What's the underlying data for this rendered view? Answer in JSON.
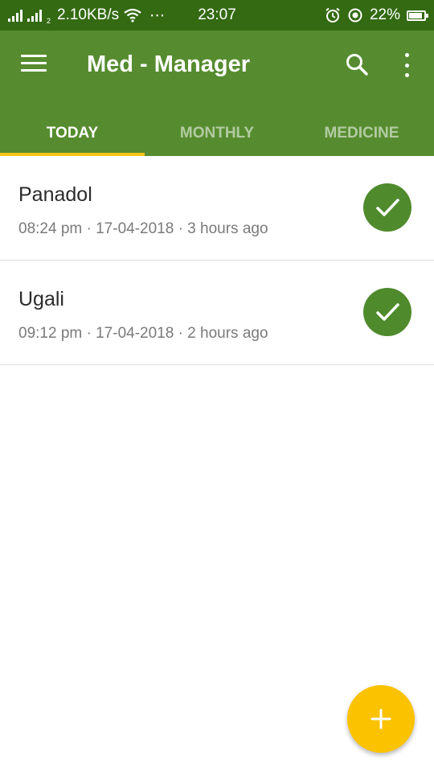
{
  "status_bar": {
    "sim_tag": "2",
    "net_speed": "2.10KB/s",
    "more": "⋯",
    "time": "23:07",
    "battery": "22%",
    "battery_level": 0.22,
    "icons": [
      "signal-icon",
      "signal-icon",
      "wifi-icon",
      "alarm-icon",
      "location-icon",
      "battery-icon"
    ]
  },
  "app_bar": {
    "title": "Med - Manager",
    "icons": [
      "menu-icon",
      "search-icon",
      "more-vert-icon"
    ]
  },
  "tabs": [
    {
      "label": "TODAY",
      "active": true
    },
    {
      "label": "MONTHLY",
      "active": false
    },
    {
      "label": "MEDICINE",
      "active": false
    }
  ],
  "entries": [
    {
      "name": "Panadol",
      "meta": "08:24 pm · 17-04-2018 · 3 hours ago",
      "status_icon": "check-circle-icon"
    },
    {
      "name": "Ugali",
      "meta": "09:12 pm · 17-04-2018 · 2 hours ago",
      "status_icon": "check-circle-icon"
    }
  ],
  "fab": {
    "icon": "plus-icon"
  },
  "colors": {
    "status_bar": "#336a12",
    "primary": "#568c2f",
    "accent": "#f5c518",
    "check": "#4f8a2c",
    "fab": "#fbc200"
  }
}
